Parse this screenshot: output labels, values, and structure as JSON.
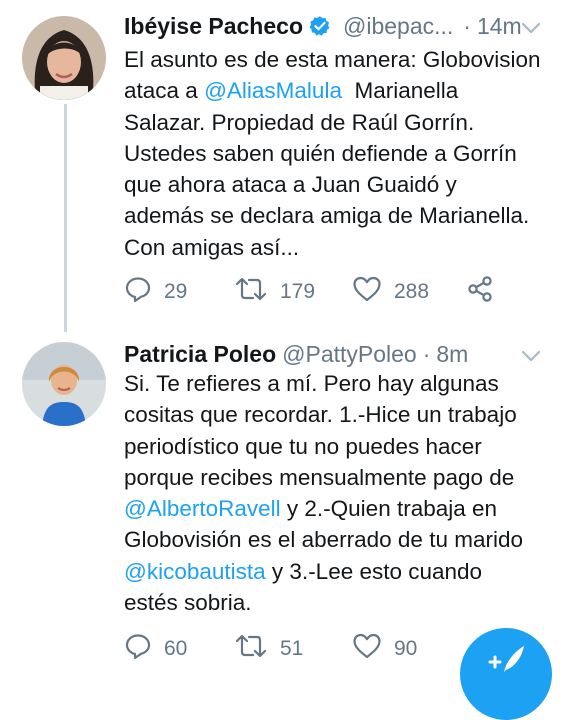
{
  "tweets": [
    {
      "name": "Ibéyise Pacheco",
      "handle": "@ibepac...",
      "time": "14m",
      "verified": true,
      "text_lines": [
        [
          {
            "t": "El asunto es de esta manera: Globovision"
          }
        ],
        [
          {
            "t": "ataca a "
          },
          {
            "t": "@AliasMalula",
            "m": true
          },
          {
            "t": "  Marianella"
          }
        ],
        [
          {
            "t": "Salazar. Propiedad de Raúl Gorrín."
          }
        ],
        [
          {
            "t": "Ustedes saben quién defiende a Gorrín"
          }
        ],
        [
          {
            "t": "que ahora ataca a Juan Guaidó y"
          }
        ],
        [
          {
            "t": "además se declara amiga de Marianella."
          }
        ],
        [
          {
            "t": "Con amigas así..."
          }
        ]
      ],
      "replies": "29",
      "retweets": "179",
      "likes": "288"
    },
    {
      "name": "Patricia Poleo",
      "handle": "@PattyPoleo",
      "time": "8m",
      "verified": false,
      "text_lines": [
        [
          {
            "t": "Si. Te refieres a mí. Pero hay algunas"
          }
        ],
        [
          {
            "t": "cositas que recordar. 1.-Hice un trabajo"
          }
        ],
        [
          {
            "t": "periodístico que tu no puedes hacer"
          }
        ],
        [
          {
            "t": "porque recibes mensualmente pago de"
          }
        ],
        [
          {
            "t": "@AlbertoRavell",
            "m": true
          },
          {
            "t": " y 2.-Quien trabaja en"
          }
        ],
        [
          {
            "t": "Globovisión es el aberrado de tu marido"
          }
        ],
        [
          {
            "t": "@kicobautista",
            "m": true
          },
          {
            "t": " y 3.-Lee esto cuando"
          }
        ],
        [
          {
            "t": "estés sobria."
          }
        ]
      ],
      "replies": "60",
      "retweets": "51",
      "likes": "90"
    }
  ],
  "icons": {
    "reply": "reply-icon",
    "retweet": "retweet-icon",
    "like": "heart-icon",
    "share": "share-icon",
    "verified": "verified-badge-icon",
    "menu": "chevron-down-icon",
    "compose": "compose-tweet-icon"
  },
  "colors": {
    "accent": "#1da1f2",
    "secondary_text": "#657786",
    "primary_text": "#14171a",
    "divider": "#e6ecf0"
  }
}
